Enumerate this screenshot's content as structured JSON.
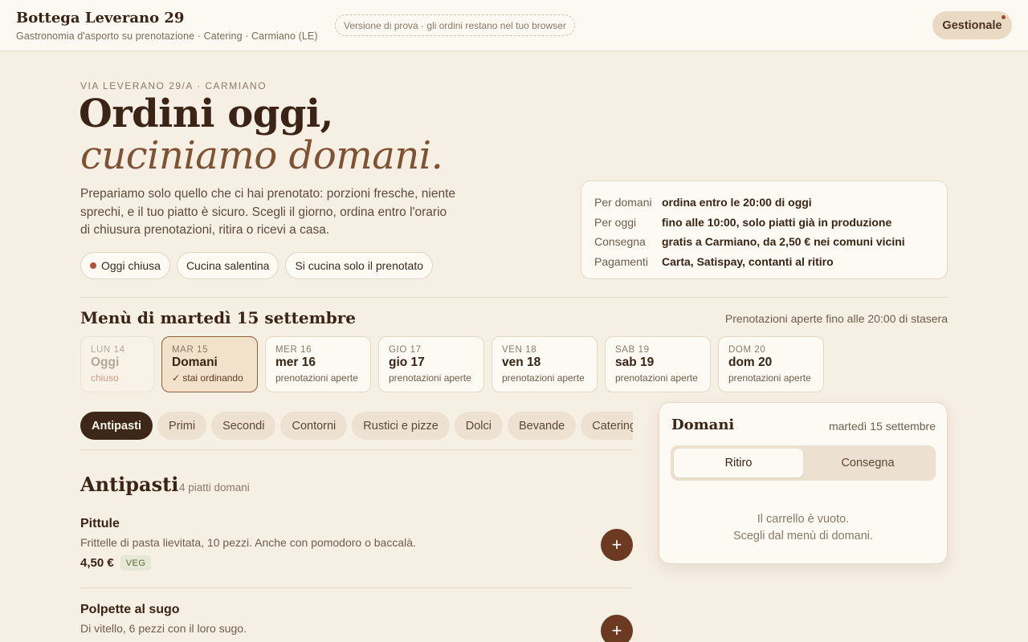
{
  "header": {
    "brand": "Bottega Leverano 29",
    "tagline": "Gastronomia d'asporto su prenotazione · Catering · Carmiano (LE)",
    "trial_note": "Versione di prova · gli ordini restano nel tuo browser",
    "manage_label": "Gestionale"
  },
  "hero": {
    "eyebrow": "VIA LEVERANO 29/A · CARMIANO",
    "line1": "Ordini oggi,",
    "line2": "cuciniamo domani.",
    "description": "Prepariamo solo quello che ci hai prenotato: porzioni fresche, niente sprechi, e il tuo piatto è sicuro. Scegli il giorno, ordina entro l'orario di chiusura prenotazioni, ritira o ricevi a casa.",
    "chips": [
      "Oggi chiusa",
      "Cucina salentina",
      "Si cucina solo il prenotato"
    ]
  },
  "info": [
    {
      "key": "Per domani",
      "value": "ordina entro le 20:00 di oggi"
    },
    {
      "key": "Per oggi",
      "value": "fino alle 10:00, solo piatti già in produzione"
    },
    {
      "key": "Consegna",
      "value": "gratis a Carmiano, da 2,50 € nei comuni vicini"
    },
    {
      "key": "Pagamenti",
      "value": "Carta, Satispay, contanti al ritiro"
    }
  ],
  "menu": {
    "title": "Menù di martedì 15 settembre",
    "note": "Prenotazioni aperte fino alle 20:00 di stasera"
  },
  "days": [
    {
      "abbr": "LUN 14",
      "name": "Oggi",
      "status": "chiuso",
      "state": "disabled"
    },
    {
      "abbr": "MAR 15",
      "name": "Domani",
      "status": "✓ stai ordinando",
      "state": "active"
    },
    {
      "abbr": "MER 16",
      "name": "mer 16",
      "status": "prenotazioni aperte",
      "state": "open"
    },
    {
      "abbr": "GIO 17",
      "name": "gio 17",
      "status": "prenotazioni aperte",
      "state": "open"
    },
    {
      "abbr": "VEN 18",
      "name": "ven 18",
      "status": "prenotazioni aperte",
      "state": "open"
    },
    {
      "abbr": "SAB 19",
      "name": "sab 19",
      "status": "prenotazioni aperte",
      "state": "open"
    },
    {
      "abbr": "DOM 20",
      "name": "dom 20",
      "status": "prenotazioni aperte",
      "state": "open"
    }
  ],
  "categories": [
    "Antipasti",
    "Primi",
    "Secondi",
    "Contorni",
    "Rustici e pizze",
    "Dolci",
    "Bevande",
    "Catering"
  ],
  "active_category": "Antipasti",
  "section": {
    "title": "Antipasti",
    "count": "4 piatti domani"
  },
  "dishes": [
    {
      "name": "Pittule",
      "desc": "Frittelle di pasta lievitata, 10 pezzi. Anche con pomodoro o baccalà.",
      "price": "4,50 €",
      "badge": "VEG",
      "add": "+"
    },
    {
      "name": "Polpette al sugo",
      "desc": "Di vitello, 6 pezzi con il loro sugo.",
      "price": "",
      "badge": "",
      "add": "+"
    }
  ],
  "cart": {
    "title": "Domani",
    "date": "martedì 15 settembre",
    "modes": [
      "Ritiro",
      "Consegna"
    ],
    "empty_line1": "Il carrello è vuoto.",
    "empty_line2": "Scegli dal menù di domani."
  }
}
